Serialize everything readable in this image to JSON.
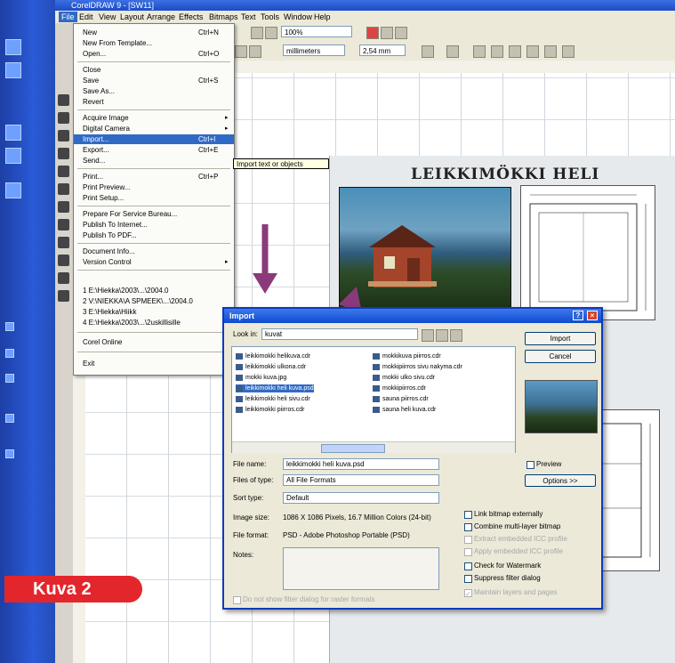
{
  "window": {
    "title": "CorelDRAW 9 - [SW11]"
  },
  "menubar": [
    "File",
    "Edit",
    "View",
    "Layout",
    "Arrange",
    "Effects",
    "Bitmaps",
    "Text",
    "Tools",
    "Window",
    "Help"
  ],
  "toolbar": {
    "zoom": "100%",
    "units": "millimeters",
    "nudge": "2,54 mm"
  },
  "file_menu": {
    "items": [
      {
        "label": "New",
        "shortcut": "Ctrl+N"
      },
      {
        "label": "New From Template...",
        "shortcut": ""
      },
      {
        "label": "Open...",
        "shortcut": "Ctrl+O"
      },
      {
        "label": "Close",
        "shortcut": ""
      },
      {
        "label": "Save",
        "shortcut": "Ctrl+S"
      },
      {
        "label": "Save As...",
        "shortcut": ""
      },
      {
        "label": "Revert",
        "shortcut": ""
      },
      {
        "label": "Acquire Image",
        "shortcut": "",
        "submenu": true
      },
      {
        "label": "Digital Camera",
        "shortcut": "",
        "submenu": true
      },
      {
        "label": "Import...",
        "shortcut": "Ctrl+I",
        "selected": true
      },
      {
        "label": "Export...",
        "shortcut": "Ctrl+E"
      },
      {
        "label": "Send...",
        "shortcut": ""
      },
      {
        "label": "Print...",
        "shortcut": "Ctrl+P"
      },
      {
        "label": "Print Preview...",
        "shortcut": ""
      },
      {
        "label": "Print Setup...",
        "shortcut": ""
      },
      {
        "label": "Prepare For Service Bureau...",
        "shortcut": ""
      },
      {
        "label": "Publish To Internet...",
        "shortcut": ""
      },
      {
        "label": "Publish To PDF...",
        "shortcut": ""
      },
      {
        "label": "Document Info...",
        "shortcut": ""
      },
      {
        "label": "Version Control",
        "shortcut": "",
        "submenu": true
      },
      {
        "label": "1 E:\\Hiekka\\2003\\...\\2004.0",
        "shortcut": ""
      },
      {
        "label": "2 V:\\NIEKKA\\A SPMEEK\\...\\2004.0",
        "shortcut": ""
      },
      {
        "label": "3 E:\\Hiekka\\Hiikk",
        "shortcut": ""
      },
      {
        "label": "4 E:\\Hiekka\\2003\\...\\2uskillisille",
        "shortcut": ""
      },
      {
        "label": "Corel Online",
        "shortcut": ""
      },
      {
        "label": "Exit",
        "shortcut": ""
      }
    ],
    "tooltip": "Import text or objects"
  },
  "page": {
    "title": "LEIKKIMÖKKI HELI"
  },
  "badge": {
    "label": "Kuva 2"
  },
  "dialog": {
    "title": "Import",
    "look_in_label": "Look in:",
    "look_in_value": "kuvat",
    "buttons": {
      "import": "Import",
      "cancel": "Cancel",
      "options": "Options >>",
      "help": "?",
      "close": "×"
    },
    "files_left": [
      "leikkimokki helikuva.cdr",
      "leikkimokki ulkona.cdr",
      "mokki kuva.jpg",
      "leikkimokki heli kuva.psd",
      "leikkimokki heli sivu.cdr",
      "leikkimokki piirros.cdr"
    ],
    "files_right": [
      "mokkikuva piirros.cdr",
      "mokkipiirros sivu nakyma.cdr",
      "mokki ulko sivu.cdr",
      "mokkipiirros.cdr",
      "sauna piirros.cdr",
      "sauna heli kuva.cdr"
    ],
    "selected_file_index": 3,
    "file_name_label": "File name:",
    "file_name_value": "leikkimokki heli kuva.psd",
    "files_of_type_label": "Files of type:",
    "files_of_type_value": "All File Formats",
    "sort_type_label": "Sort type:",
    "sort_type_value": "Default",
    "image_size_label": "Image size:",
    "image_size_value": "1086 X 1086 Pixels, 16.7 Million Colors (24-bit)",
    "file_format_label": "File format:",
    "file_format_value": "PSD - Adobe Photoshop Portable (PSD)",
    "notes_label": "Notes:",
    "preview_label": "Preview",
    "options": [
      {
        "label": "Link bitmap externally",
        "checked": false,
        "enabled": true
      },
      {
        "label": "Combine multi-layer bitmap",
        "checked": false,
        "enabled": true
      },
      {
        "label": "Extract embedded ICC profile",
        "checked": false,
        "enabled": false
      },
      {
        "label": "Apply embedded ICC profile",
        "checked": false,
        "enabled": false
      },
      {
        "label": "Check for Watermark",
        "checked": false,
        "enabled": true
      },
      {
        "label": "Suppress filter dialog",
        "checked": false,
        "enabled": true
      },
      {
        "label": "Maintain layers and pages",
        "checked": true,
        "enabled": false
      }
    ],
    "bottom_check": "Do not show filter dialog for raster formats"
  }
}
